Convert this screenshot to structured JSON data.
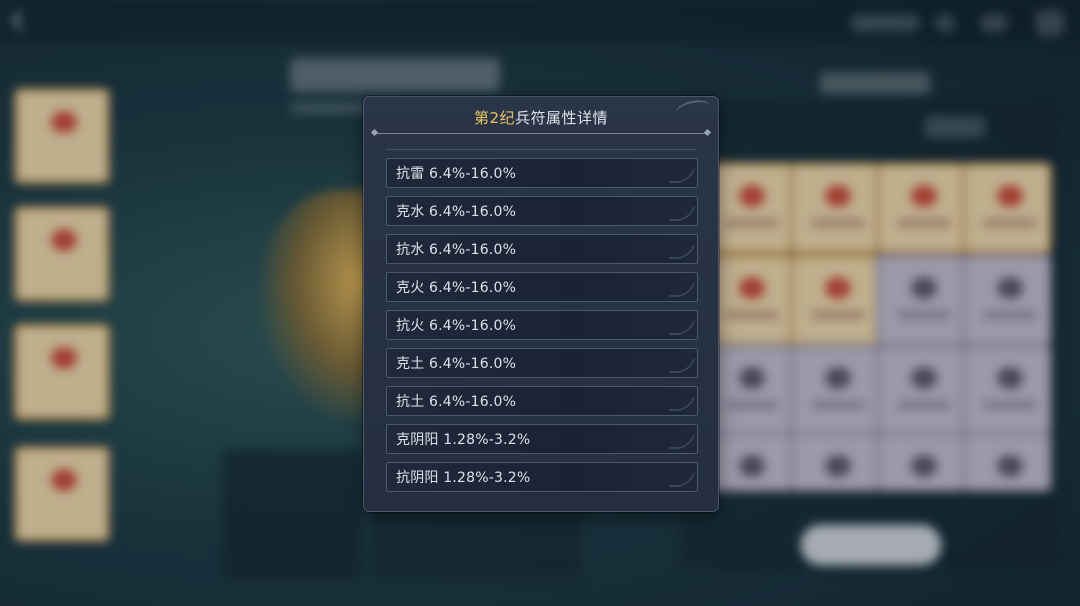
{
  "dialog": {
    "title_accent": "第2纪",
    "title_rest": "兵符属性详情",
    "attributes": [
      "抗雷 6.4%-16.0%",
      "克水 6.4%-16.0%",
      "抗水 6.4%-16.0%",
      "克火 6.4%-16.0%",
      "抗火 6.4%-16.0%",
      "克土 6.4%-16.0%",
      "抗土 6.4%-16.0%",
      "克阴阳 1.28%-3.2%",
      "抗阴阳 1.28%-3.2%"
    ]
  },
  "colors": {
    "title_accent": "#e8c467",
    "modal_bg": "#242e3f",
    "row_border": "#4a5870"
  }
}
